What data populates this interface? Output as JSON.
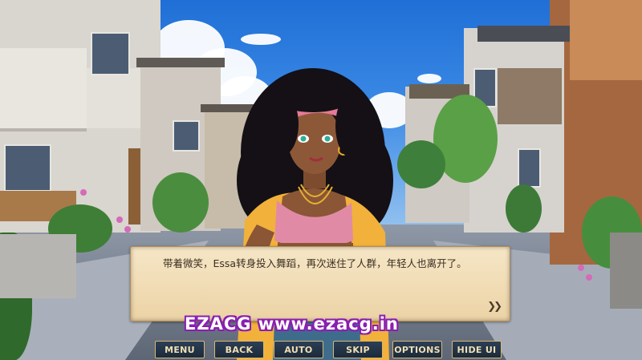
{
  "dialogue": {
    "text": "带着微笑，Essa转身投入舞蹈，再次迷住了人群，年轻人也离开了。",
    "advance_icon": "double-chevron-right-icon"
  },
  "watermark": {
    "text": "EZACG www.ezacg.in"
  },
  "menu": {
    "buttons": [
      {
        "label": "MENU"
      },
      {
        "label": "BACK"
      },
      {
        "label": "AUTO"
      },
      {
        "label": "SKIP"
      },
      {
        "label": "OPTIONS"
      },
      {
        "label": "HIDE UI"
      }
    ]
  },
  "colors": {
    "dialog_bg": "#f3e1bc",
    "dialog_text": "#3b2e21",
    "button_bg": "#22344a",
    "button_border": "#d9b673",
    "button_text": "#f1dfb4",
    "watermark_outline": "#8a1fb0"
  }
}
